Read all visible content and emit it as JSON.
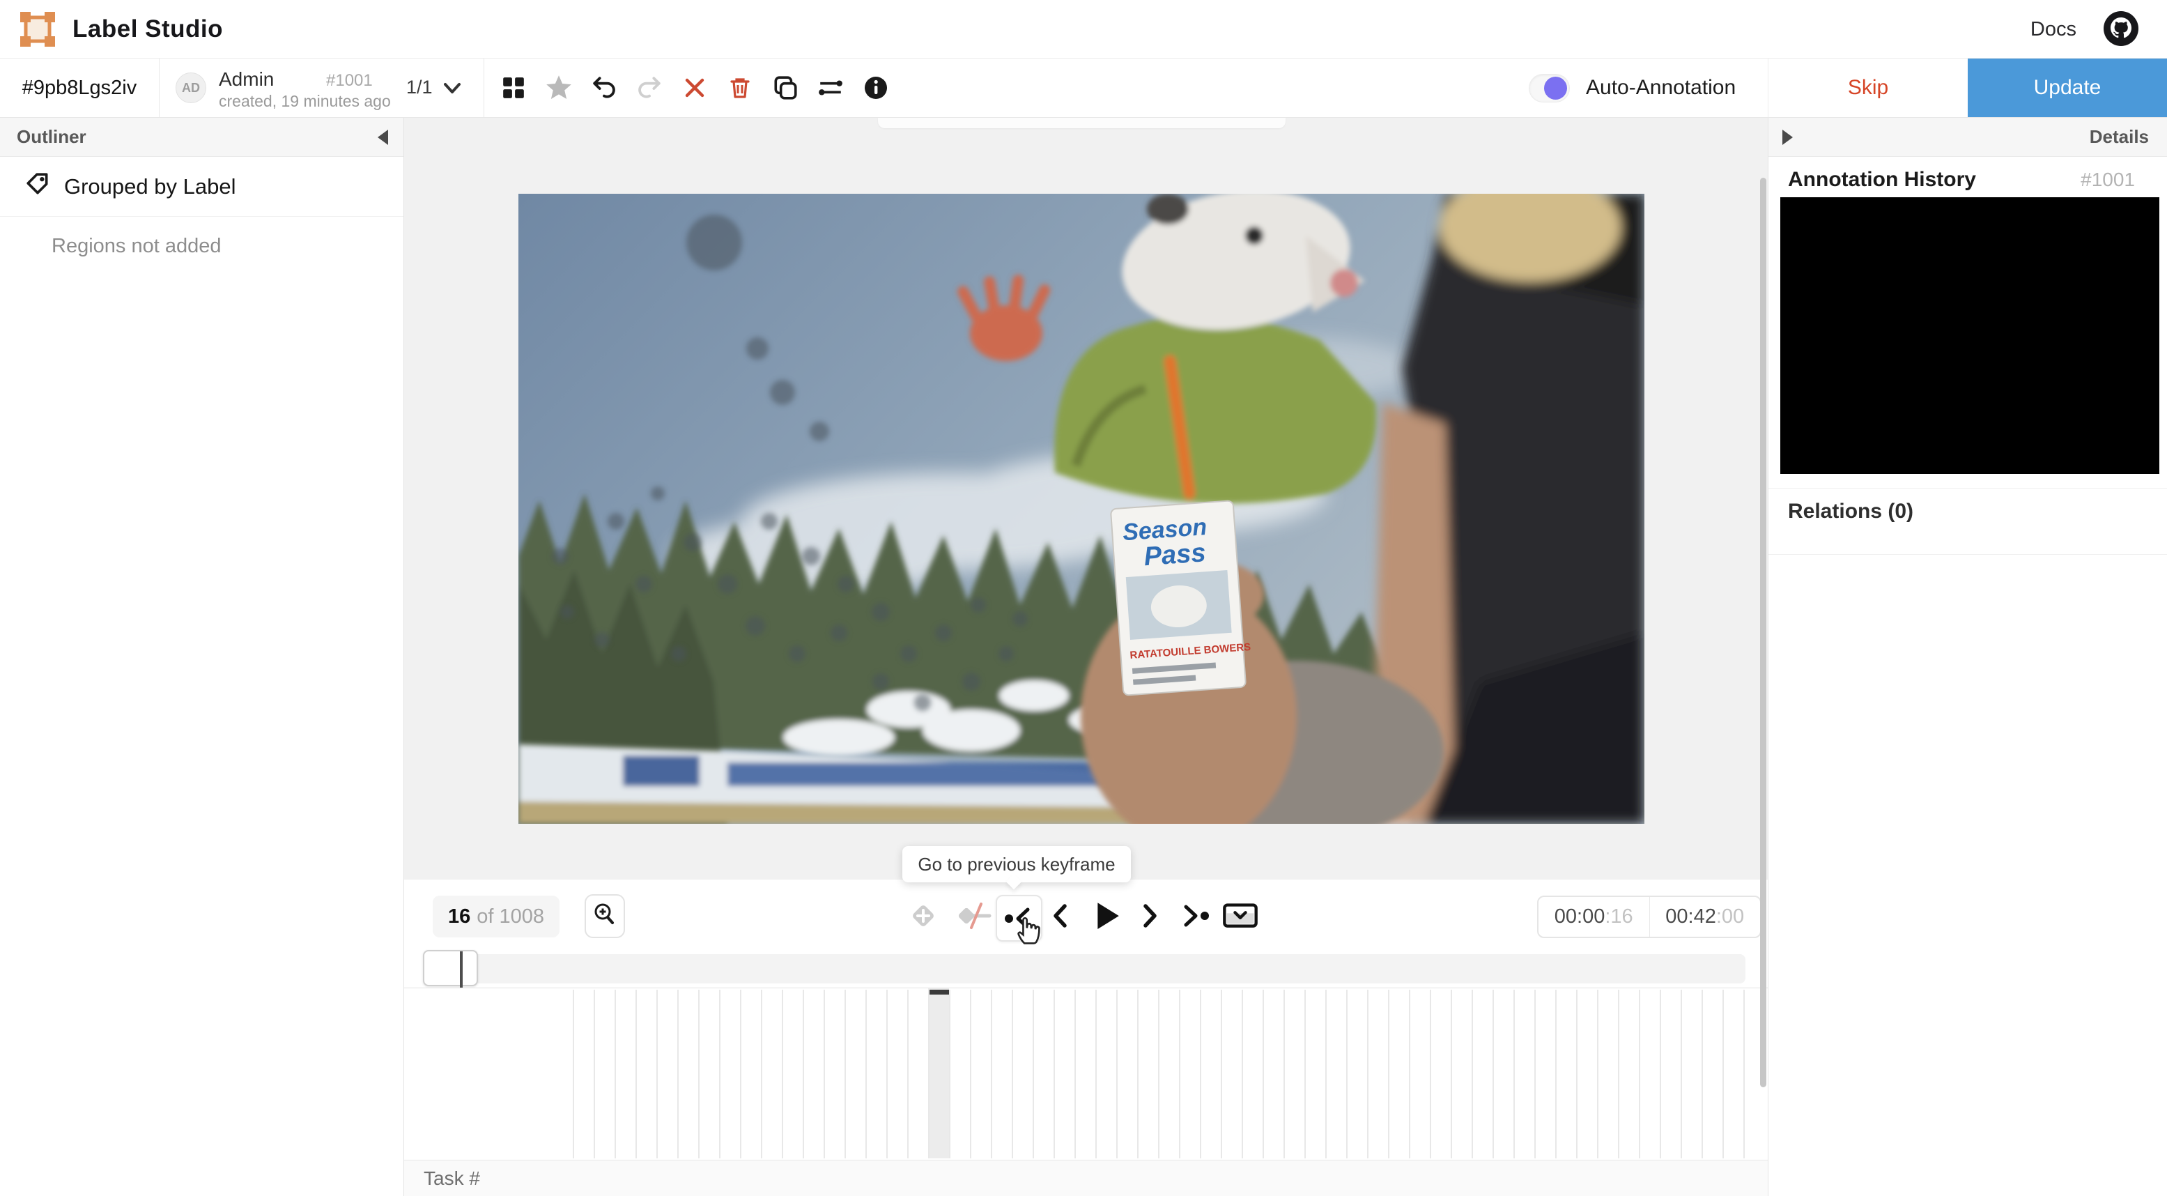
{
  "header": {
    "app_title": "Label Studio",
    "docs_label": "Docs"
  },
  "taskbar": {
    "task_id": "#9pb8Lgs2iv",
    "user_initials": "AD",
    "user_name": "Admin",
    "created": "created, 19 minutes ago",
    "annotation_id": "#1001",
    "pagination": "1/1",
    "toolbar_icon_names": [
      "grid-view-icon",
      "star-icon",
      "undo-icon",
      "redo-icon",
      "reject-icon",
      "delete-icon",
      "duplicate-icon",
      "relations-icon",
      "info-icon"
    ],
    "auto_annotation_label": "Auto-Annotation",
    "skip_label": "Skip",
    "update_label": "Update"
  },
  "outliner": {
    "title": "Outliner",
    "grouped_label": "Grouped by Label",
    "empty_text": "Regions not added"
  },
  "details": {
    "title": "Details",
    "history_title": "Annotation History",
    "history_id": "#1001",
    "relations_title": "Relations (0)"
  },
  "video": {
    "card_line1": "Season",
    "card_line2": "Pass",
    "card_small": "RATATOUILLE BOWERS"
  },
  "player": {
    "frame_number": "16",
    "frame_total": "of 1008",
    "tooltip": "Go to previous keyframe",
    "time_elapsed": "00:00",
    "time_elapsed_frames": ":16",
    "time_total": "00:42",
    "time_total_frames": ":00"
  },
  "footer": {
    "task_label": "Task #"
  },
  "colors": {
    "accent": "#4b99d9",
    "danger": "#d64527",
    "toggle_on": "#7b70f1",
    "logo": "#df8e51"
  }
}
